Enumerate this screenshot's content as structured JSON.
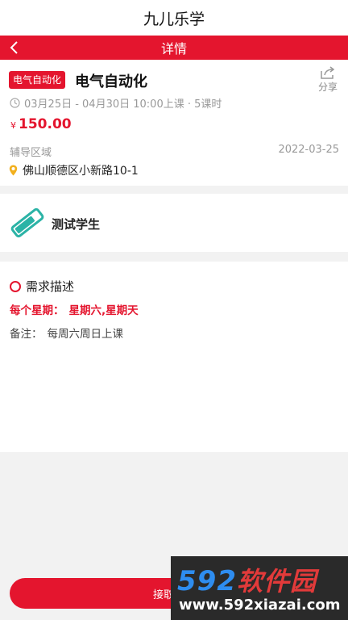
{
  "app": {
    "title": "九儿乐学"
  },
  "nav": {
    "title": "详情"
  },
  "course": {
    "tag": "电气自动化",
    "title": "电气自动化",
    "share_label": "分享",
    "schedule": "03月25日 - 04月30日 10:00上课 · 5课时",
    "price_currency": "¥",
    "price": "150.00",
    "area_label": "辅导区域",
    "date": "2022-03-25",
    "address": "佛山顺德区小新路10-1"
  },
  "student": {
    "name": "测试学生"
  },
  "requirements": {
    "heading": "需求描述",
    "weekly_label": "每个星期：",
    "weekly_days": "星期六,星期天",
    "note_label": "备注：",
    "note_value": "每周六周日上课"
  },
  "footer": {
    "accept_label": "接取订单"
  },
  "watermark": {
    "top_num": "592",
    "top_cn": "软件园",
    "url": "www.592xiazai.com"
  },
  "colors": {
    "accent": "#e4152e",
    "muted": "#999999",
    "background": "#f2f2f2"
  }
}
